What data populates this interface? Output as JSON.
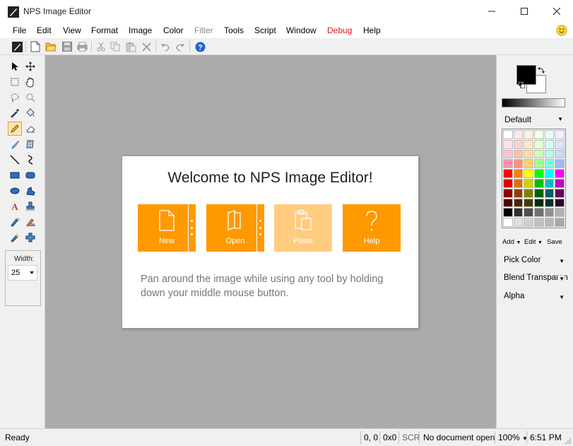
{
  "window": {
    "title": "NPS Image Editor",
    "controls": [
      "minimize-icon",
      "maximize-icon",
      "close-icon"
    ]
  },
  "menu": {
    "items": [
      {
        "label": "File",
        "state": "normal"
      },
      {
        "label": "Edit",
        "state": "normal"
      },
      {
        "label": "View",
        "state": "normal"
      },
      {
        "label": "Format",
        "state": "normal"
      },
      {
        "label": "Image",
        "state": "normal"
      },
      {
        "label": "Color",
        "state": "normal"
      },
      {
        "label": "Filter",
        "state": "disabled"
      },
      {
        "label": "Tools",
        "state": "normal"
      },
      {
        "label": "Script",
        "state": "normal"
      },
      {
        "label": "Window",
        "state": "normal"
      },
      {
        "label": "Debug",
        "state": "highlight"
      },
      {
        "label": "Help",
        "state": "normal"
      }
    ],
    "colors": {
      "disabled": "#888888",
      "highlight": "#e81123"
    },
    "feedback_icon": "smiley-icon"
  },
  "toolbar": {
    "buttons": [
      "app-logo-icon",
      "new-file-icon",
      "open-folder-icon",
      "save-icon",
      "print-icon",
      "cut-icon",
      "copy-icon",
      "paste-icon",
      "delete-icon",
      "undo-icon",
      "redo-icon",
      "help-icon"
    ]
  },
  "tools": {
    "items": [
      "pointer-tool-icon",
      "move-tool-icon",
      "rect-select-icon",
      "hand-tool-icon",
      "lasso-select-icon",
      "zoom-tool-icon",
      "eyedropper-icon",
      "fill-bucket-icon",
      "pencil-icon",
      "eraser-icon",
      "brush-icon",
      "stamp-icon",
      "line-tool-icon",
      "curve-tool-icon",
      "rectangle-tool-icon",
      "rounded-rect-tool-icon",
      "ellipse-tool-icon",
      "freeform-shape-icon",
      "text-tool-icon",
      "clone-stamp-icon",
      "airbrush-icon",
      "recolor-icon",
      "smudge-icon",
      "add-tool-icon"
    ],
    "active": "pencil-icon",
    "width_label": "Width:",
    "width_value": "25"
  },
  "welcome": {
    "title": "Welcome to NPS Image Editor!",
    "tiles": [
      {
        "label": "New",
        "icon": "new-document-icon",
        "enabled": true,
        "has_split": true
      },
      {
        "label": "Open",
        "icon": "open-document-icon",
        "enabled": true,
        "has_split": true
      },
      {
        "label": "Paste",
        "icon": "paste-clipboard-icon",
        "enabled": false,
        "has_split": false
      },
      {
        "label": "Help",
        "icon": "question-mark-icon",
        "enabled": true,
        "has_split": false
      }
    ],
    "hint": "Pan around the image while using any tool by holding down your middle mouse button.",
    "accent": "#ff9900",
    "accent_disabled": "#ffcc80"
  },
  "colors_panel": {
    "primary": "#000000",
    "secondary": "#ffffff",
    "palette_name": "Default",
    "palette": [
      "#ffffff",
      "#ffe8e8",
      "#fff0e0",
      "#f0ffe8",
      "#e8fff8",
      "#f0f0ff",
      "#ffe0f0",
      "#ffd0d0",
      "#ffe8c8",
      "#e8ffd0",
      "#d0fff0",
      "#e0e0ff",
      "#ffc0d8",
      "#ffc0a8",
      "#ffe0a0",
      "#d0ffb0",
      "#b0fff0",
      "#c8d8ff",
      "#ff90b0",
      "#ff9080",
      "#ffd070",
      "#a0ff90",
      "#80ffe0",
      "#a0b8ff",
      "#ff0000",
      "#ff8000",
      "#ffff00",
      "#00ff00",
      "#00ffff",
      "#ff00ff",
      "#e00000",
      "#e07000",
      "#d0d000",
      "#00c000",
      "#00c0c0",
      "#c000c0",
      "#900000",
      "#904000",
      "#808000",
      "#006000",
      "#006060",
      "#600060",
      "#500000",
      "#502000",
      "#404000",
      "#003000",
      "#003030",
      "#300030",
      "#000000",
      "#303030",
      "#505050",
      "#707070",
      "#909090",
      "#b0b0b0",
      "#ffffff",
      "#e0e0e0",
      "#d0d0d0",
      "#c0c0c0",
      "#b8b8b8",
      "#a8a8a8"
    ],
    "actions": [
      {
        "label": "Add",
        "dropdown": true
      },
      {
        "label": "Edit",
        "dropdown": true
      },
      {
        "label": "Save",
        "dropdown": false
      }
    ],
    "dropdowns": [
      "Pick Color",
      "Blend Transparent",
      "Alpha"
    ]
  },
  "status": {
    "ready": "Ready",
    "coords": "0, 0",
    "size": "0x0",
    "scr": "SCR",
    "document": "No document open",
    "zoom": "100%",
    "time": "6:51 PM"
  }
}
